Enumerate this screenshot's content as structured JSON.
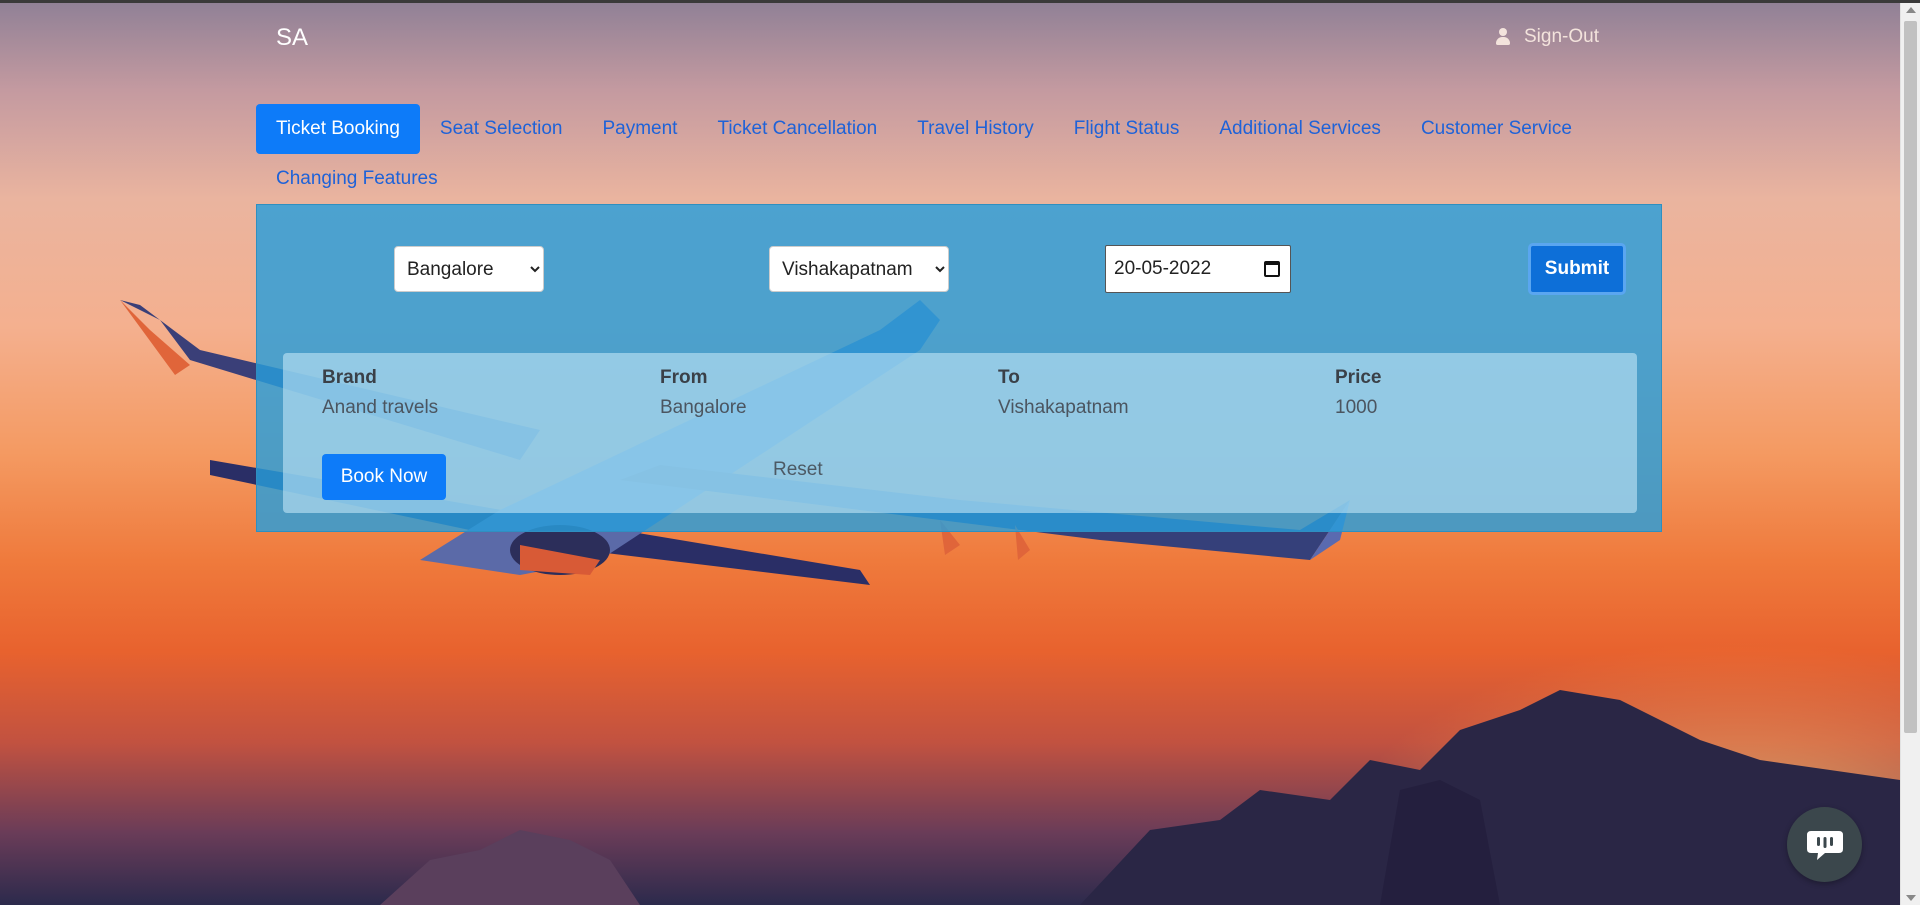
{
  "header": {
    "brand": "SA",
    "signout_label": "Sign-Out",
    "signout_icon": "user-icon"
  },
  "tabs": [
    {
      "label": "Ticket Booking",
      "active": true
    },
    {
      "label": "Seat Selection",
      "active": false
    },
    {
      "label": "Payment",
      "active": false
    },
    {
      "label": "Ticket Cancellation",
      "active": false
    },
    {
      "label": "Travel History",
      "active": false
    },
    {
      "label": "Flight Status",
      "active": false
    },
    {
      "label": "Additional Services",
      "active": false
    },
    {
      "label": "Customer Service",
      "active": false
    },
    {
      "label": "Changing Features",
      "active": false
    }
  ],
  "search": {
    "from_value": "Bangalore",
    "to_value": "Vishakapatnam",
    "date_value": "20-05-2022",
    "submit_label": "Submit"
  },
  "results": {
    "headers": {
      "brand": "Brand",
      "from": "From",
      "to": "To",
      "price": "Price"
    },
    "row": {
      "brand": "Anand travels",
      "from": "Bangalore",
      "to": "Vishakapatnam",
      "price": "1000"
    },
    "book_label": "Book Now",
    "reset_label": "Reset"
  },
  "chat": {
    "icon": "chat-bubble-icon"
  },
  "colors": {
    "accent": "#0d7bf9",
    "panel": "#289eda",
    "link": "#1e62d8"
  }
}
